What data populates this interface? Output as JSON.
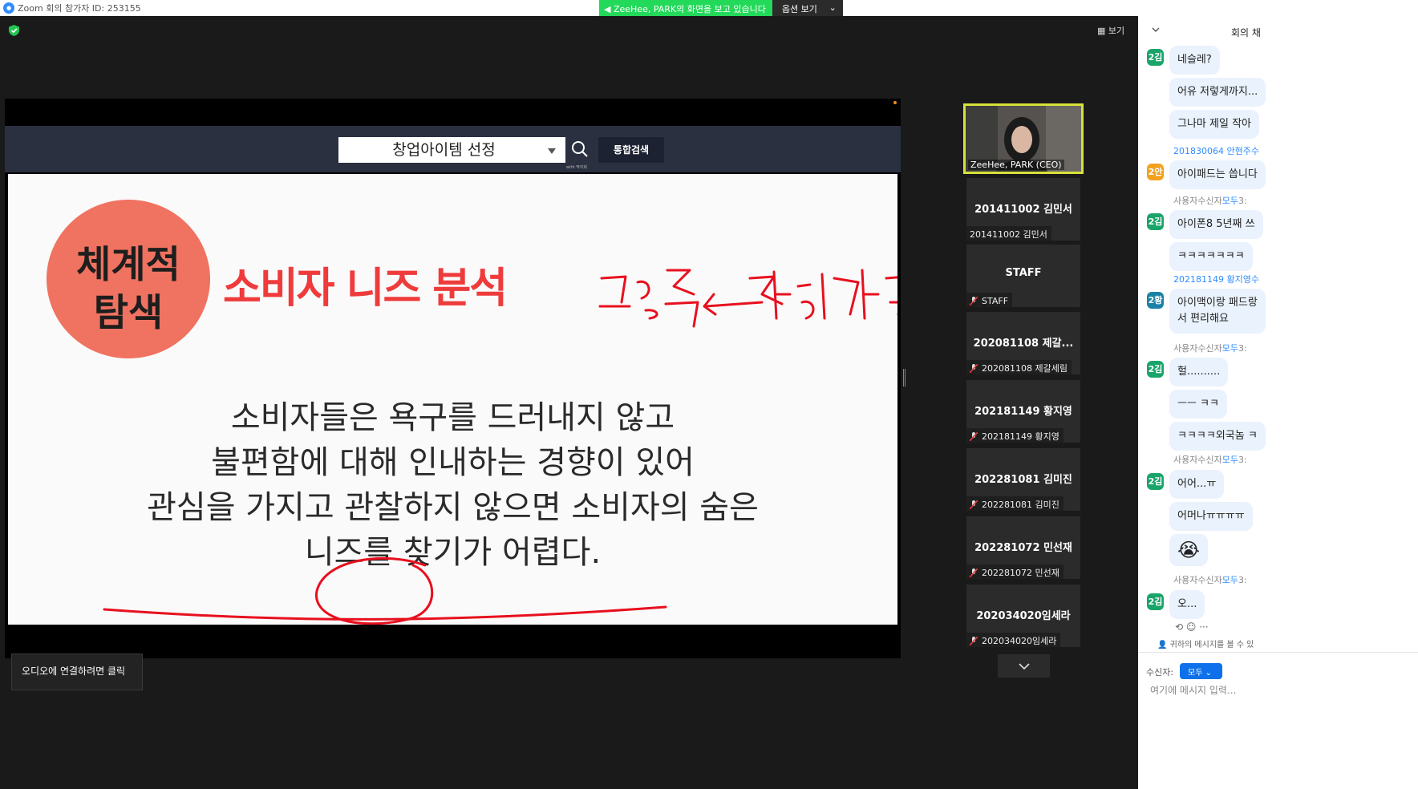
{
  "window": {
    "title": "Zoom 회의 참가자 ID: 253155"
  },
  "banner": {
    "sharing": "ZeeHee, PARK의 화면을 보고 있습니다",
    "options": "옵션 보기"
  },
  "toolbar": {
    "view": "보기"
  },
  "shared_screen": {
    "search_value": "창업아이템 선정",
    "search_sub": "with 딱지희",
    "search_button": "통합검색",
    "bubble_line1": "체계적",
    "bubble_line2": "탐색",
    "slide_title": "소비자 니즈 분석",
    "body_lines": [
      "소비자들은 욕구를 드러내지 않고",
      "불편함에 대해 인내하는 경향이 있어",
      "관심을 가지고 관찰하지 않으면 소비자의 숨은",
      "니즈를 찾기가 어렵다."
    ],
    "annotation_color": "#e8101e"
  },
  "audio_tip": "오디오에 연결하려면 클릭",
  "participants": [
    {
      "video": true,
      "label": "ZeeHee, PARK (CEO)"
    },
    {
      "name": "201411002 김민서",
      "label": "201411002 김민서",
      "muted": false
    },
    {
      "name": "STAFF",
      "label": "STAFF",
      "muted": true
    },
    {
      "name": "202081108 제갈...",
      "label": "202081108 제갈세림",
      "muted": true
    },
    {
      "name": "202181149 황지영",
      "label": "202181149 황지영",
      "muted": true
    },
    {
      "name": "202281081 김미진",
      "label": "202281081 김미진",
      "muted": true
    },
    {
      "name": "202281072 민선재",
      "label": "202281072 민선재",
      "muted": true
    },
    {
      "name": "202034020임세라",
      "label": "202034020임세라",
      "muted": true
    }
  ],
  "chat": {
    "header": "회의 채",
    "messages": [
      {
        "avatar": "2김",
        "avatar_color": "#1aa46a",
        "text": "네슬레?"
      },
      {
        "text": "어유 저렇게까지..."
      },
      {
        "text": "그나마 제일 작아"
      },
      {
        "sender_id": "201830064",
        "sender_name": "안현주",
        "sender_suffix": "수"
      },
      {
        "avatar": "2안",
        "avatar_color": "#f2a11f",
        "text": "아이패드는 씁니다"
      },
      {
        "sender_name": "사용자",
        "sender_mid": "수신자",
        "sender_to": "모두",
        "sender_time": "3:"
      },
      {
        "avatar": "2김",
        "avatar_color": "#1aa46a",
        "text": "아이폰8 5년째 쓰"
      },
      {
        "text": "ㅋㅋㅋㅋㅋㅋㅋ"
      },
      {
        "sender_id": "202181149",
        "sender_name": "황지영",
        "sender_suffix": "수"
      },
      {
        "avatar": "2황",
        "avatar_color": "#1a82a6",
        "text": "아이맥이랑 패드랑",
        "text2": "서 편리해요"
      },
      {
        "sender_name": "사용자",
        "sender_mid": "수신자",
        "sender_to": "모두",
        "sender_time": "3:"
      },
      {
        "avatar": "2김",
        "avatar_color": "#1aa46a",
        "text": "헐.........."
      },
      {
        "text": "ㅡㅡ ㅋㅋ"
      },
      {
        "text": "ㅋㅋㅋㅋ외국놈 ㅋ"
      },
      {
        "sender_name": "사용자",
        "sender_mid": "수신자",
        "sender_to": "모두",
        "sender_time": "3:"
      },
      {
        "avatar": "2김",
        "avatar_color": "#1aa46a",
        "text": "어어...ㅠ"
      },
      {
        "text": "어머나ㅠㅠㅠㅠ"
      },
      {
        "emoji": "😭"
      },
      {
        "sender_name": "사용자",
        "sender_mid": "수신자",
        "sender_to": "모두",
        "sender_time": "3:"
      },
      {
        "avatar": "2김",
        "avatar_color": "#1aa46a",
        "text": "오..."
      }
    ],
    "footer_note": "귀하의 메시지를 볼 수 있",
    "recipient_label": "수신자:",
    "recipient_value": "모두",
    "input_placeholder": "여기에 메시지 입력..."
  }
}
